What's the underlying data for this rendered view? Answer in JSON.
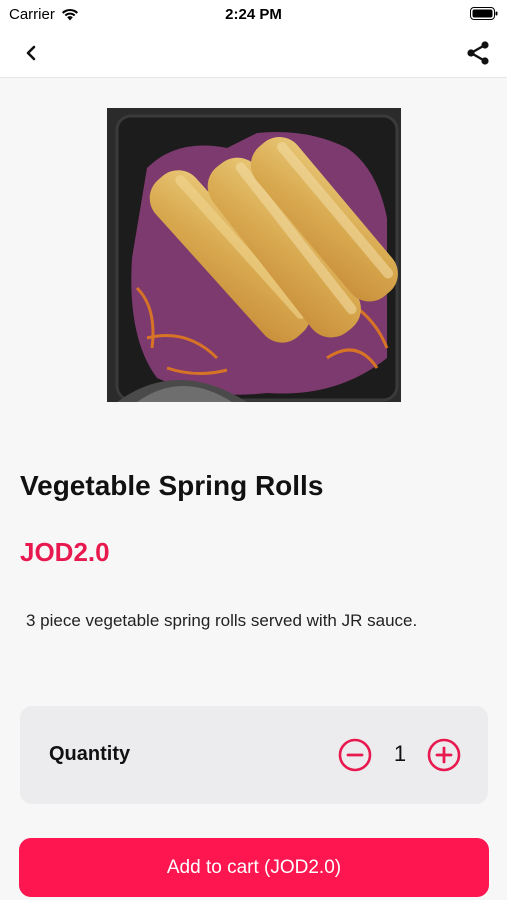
{
  "status_bar": {
    "carrier": "Carrier",
    "time": "2:24 PM",
    "wifi_icon": "wifi-icon",
    "battery_icon": "battery-icon"
  },
  "nav": {
    "back_icon": "chevron-left-icon",
    "share_icon": "share-icon"
  },
  "product": {
    "image": "spring-rolls-photo",
    "title": "Vegetable Spring Rolls",
    "price": "JOD2.0",
    "description": "3 piece vegetable spring rolls served with JR sauce."
  },
  "quantity": {
    "label": "Quantity",
    "value": "1",
    "minus_icon": "minus-circle-icon",
    "plus_icon": "plus-circle-icon"
  },
  "cart": {
    "button_label": "Add to cart (JOD2.0)"
  },
  "colors": {
    "accent": "#e8194f",
    "button": "#fd1650",
    "background": "#f7f7f7",
    "card": "#ececee"
  }
}
